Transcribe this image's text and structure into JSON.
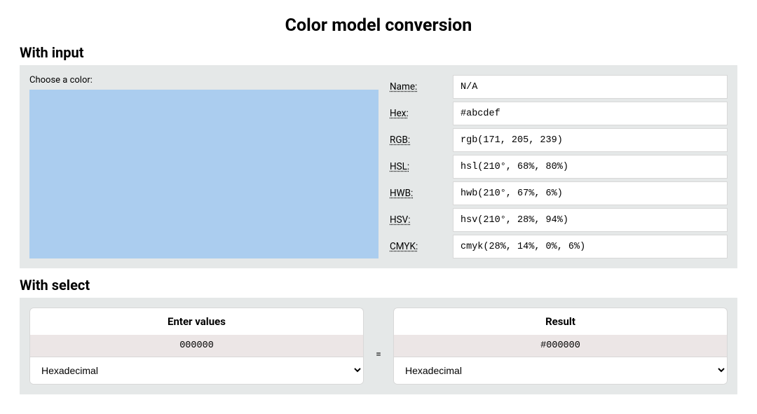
{
  "title": "Color model conversion",
  "with_input": {
    "heading": "With input",
    "chooser_label": "Choose a color:",
    "swatch_color": "#abcdef",
    "rows": [
      {
        "label": "Name:",
        "value": "N/A"
      },
      {
        "label": "Hex:",
        "value": "#abcdef"
      },
      {
        "label": "RGB:",
        "value": "rgb(171, 205, 239)"
      },
      {
        "label": "HSL:",
        "value": "hsl(210°, 68%, 80%)"
      },
      {
        "label": "HWB:",
        "value": "hwb(210°, 67%, 6%)"
      },
      {
        "label": "HSV:",
        "value": "hsv(210°, 28%, 94%)"
      },
      {
        "label": "CMYK:",
        "value": "cmyk(28%, 14%, 0%, 6%)"
      }
    ]
  },
  "with_select": {
    "heading": "With select",
    "equals": "=",
    "left": {
      "header": "Enter values",
      "value": "000000",
      "select": "Hexadecimal"
    },
    "right": {
      "header": "Result",
      "value": "#000000",
      "select": "Hexadecimal"
    }
  }
}
